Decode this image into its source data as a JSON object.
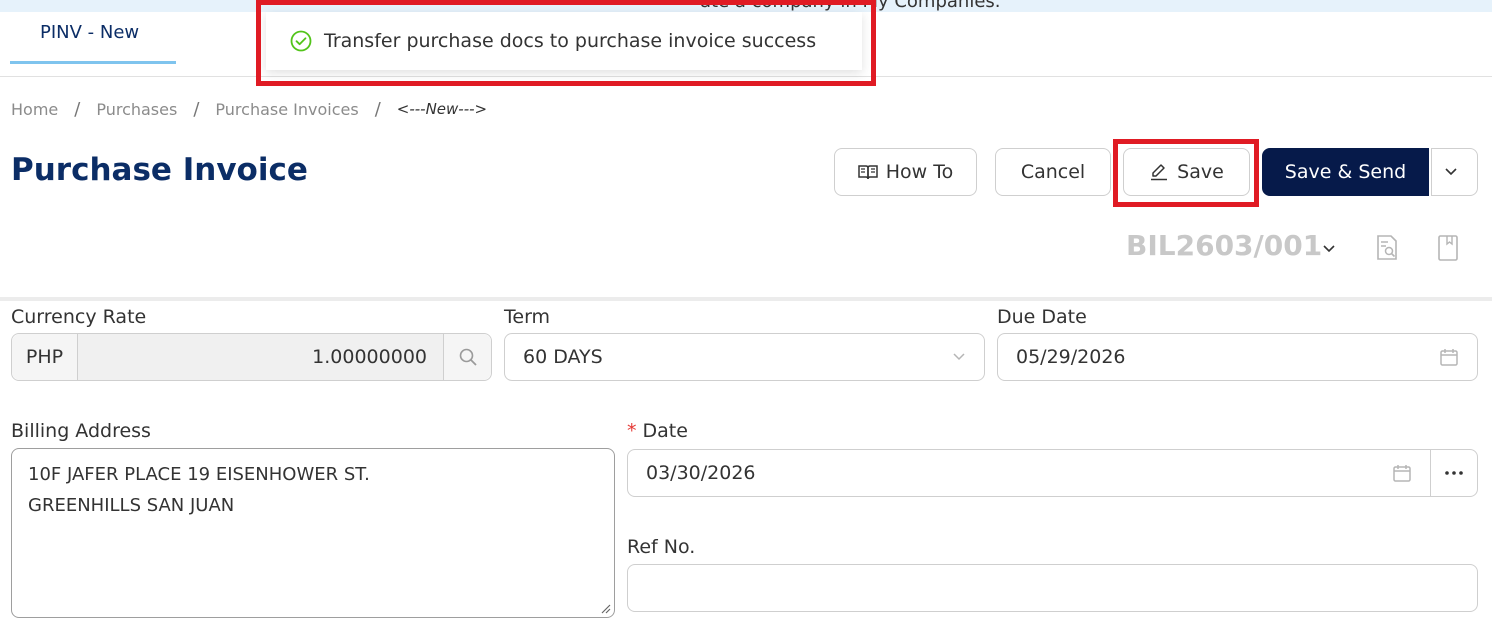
{
  "banner": {
    "text": "ate a company in My Companies."
  },
  "tab": {
    "label": "PINV - New"
  },
  "toast": {
    "message": "Transfer purchase docs to purchase invoice success"
  },
  "breadcrumb": {
    "items": [
      "Home",
      "Purchases",
      "Purchase Invoices"
    ],
    "current": "<---New--->",
    "separator": "/"
  },
  "page": {
    "title": "Purchase Invoice"
  },
  "actions": {
    "how_to": "How To",
    "cancel": "Cancel",
    "save": "Save",
    "save_send": "Save & Send"
  },
  "document": {
    "number": "BIL2603/001"
  },
  "form": {
    "currency_rate": {
      "label": "Currency Rate",
      "currency": "PHP",
      "value": "1.00000000"
    },
    "term": {
      "label": "Term",
      "value": "60 DAYS"
    },
    "due_date": {
      "label": "Due Date",
      "value": "05/29/2026"
    },
    "billing_address": {
      "label": "Billing Address",
      "line1": "10F JAFER PLACE 19 EISENHOWER ST.",
      "line2": "GREENHILLS SAN JUAN"
    },
    "date": {
      "label": "Date",
      "required_mark": "*",
      "value": "03/30/2026"
    },
    "ref_no": {
      "label": "Ref No.",
      "value": ""
    }
  },
  "colors": {
    "brand_navy": "#061a4a",
    "title_navy": "#0b2d66",
    "highlight_red": "#e01b24",
    "success_green": "#52c41a",
    "tab_underline": "#7fc4ee"
  }
}
